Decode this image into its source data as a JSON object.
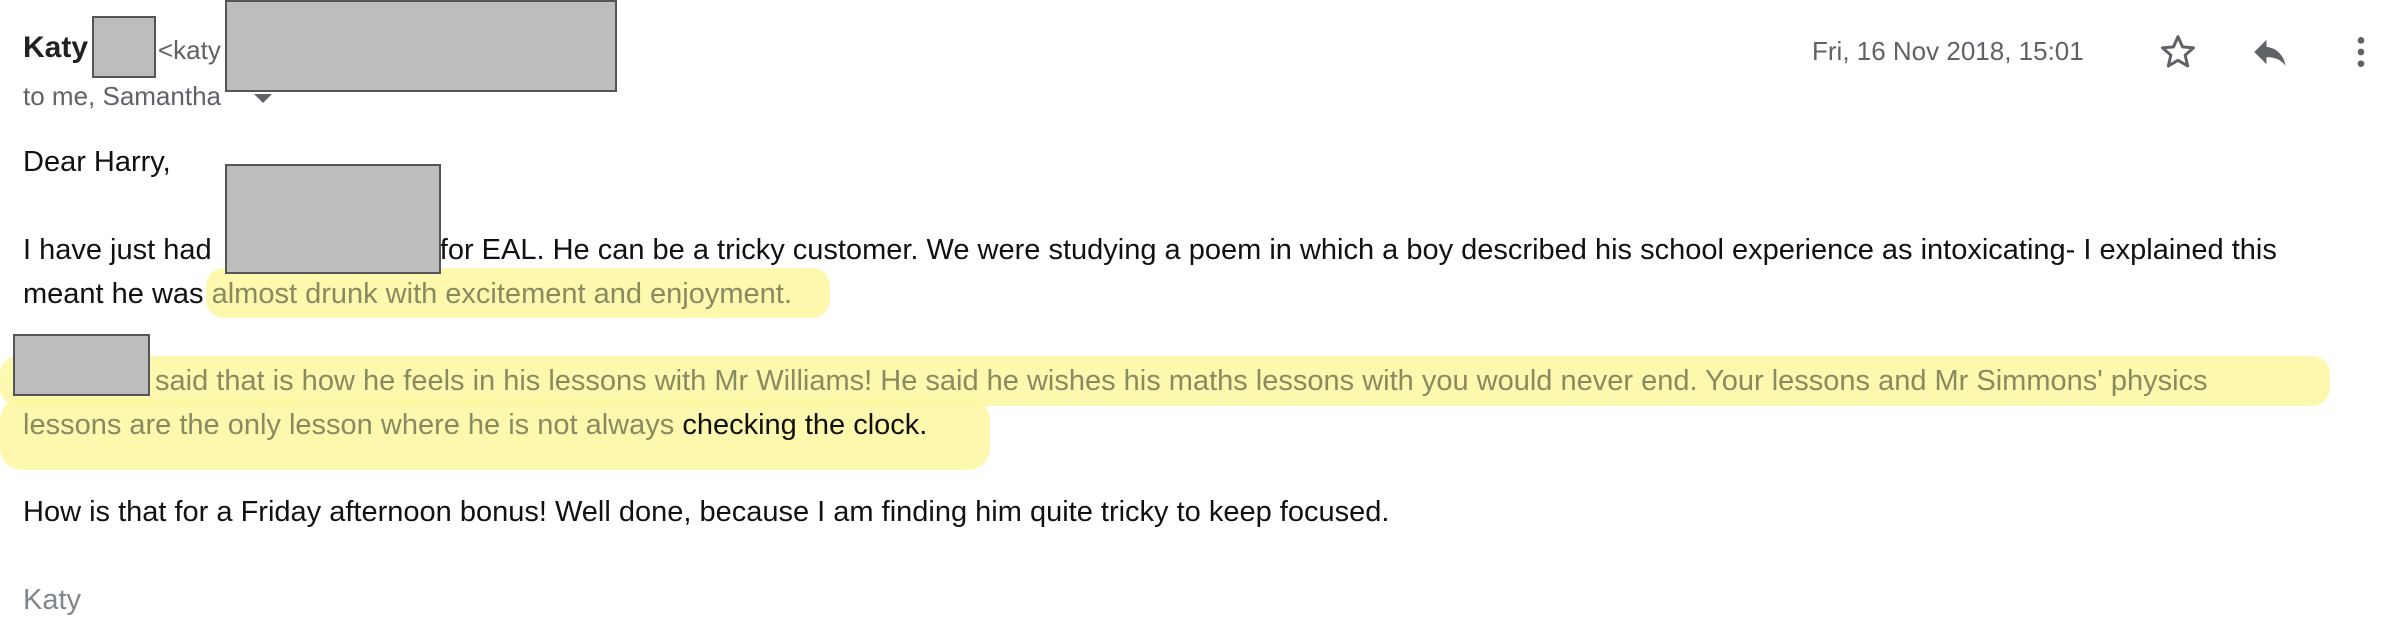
{
  "header": {
    "sender_name": "Katy",
    "sender_email_prefix": "<katy",
    "recipients_label": "to me, Samantha",
    "date": "Fri, 16 Nov 2018, 15:01",
    "star_icon": "star-outline-icon",
    "reply_icon": "reply-icon",
    "more_icon": "more-vert-icon"
  },
  "body": {
    "greeting": "Dear Harry,",
    "para1_line1_a": "I have just had",
    "para1_line1_b": "for EAL. He can be a tricky customer. We were studying a poem in which a boy described his school experience as intoxicating- I explained this",
    "para1_line2_a": "meant he was",
    "para1_line2_b": "almost drunk with excitement and enjoyment.",
    "para2_line1": "said that is how he feels in his lessons with Mr Williams! He said he wishes his maths lessons with you would never end. Your lessons and Mr Simmons' physics",
    "para2_line2_a": "lessons are the only lesson where he is not always",
    "para2_line2_b": "checking the clock.",
    "para3": "How is that for a Friday afternoon bonus! Well done, because I am finding him quite tricky to keep focused.",
    "signature": "Katy"
  },
  "colors": {
    "highlight": "#fbf7a0",
    "redaction": "#bdbdbd",
    "text": "#111111",
    "muted": "#5f6368"
  }
}
